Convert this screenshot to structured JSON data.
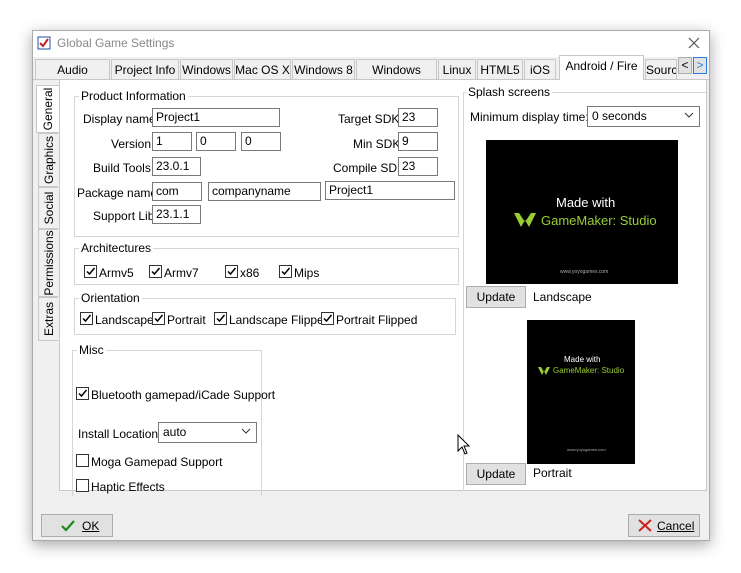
{
  "window": {
    "title": "Global Game Settings"
  },
  "tabs": [
    "Audio Groups",
    "Project Info",
    "Windows",
    "Mac OS X",
    "Windows 8",
    "Windows UWP",
    "Linux",
    "HTML5",
    "iOS",
    "Android / Fire",
    "Sourc"
  ],
  "tab_nav": {
    "prev": "<",
    "next": ">"
  },
  "side_tabs": [
    "General",
    "Graphics",
    "Social",
    "Permissions",
    "Extras"
  ],
  "product": {
    "heading": "Product Information",
    "display_name_label": "Display name",
    "display_name": "Project1",
    "version_label": "Version",
    "version": [
      "1",
      "0",
      "0"
    ],
    "build_tools_label": "Build Tools",
    "build_tools": "23.0.1",
    "package_label": "Package name",
    "package": [
      "com",
      "companyname",
      "Project1"
    ],
    "support_lib_label": "Support Lib",
    "support_lib": "23.1.1",
    "target_sdk_label": "Target SDK",
    "target_sdk": "23",
    "min_sdk_label": "Min SDK",
    "min_sdk": "9",
    "compile_sdk_label": "Compile SDK",
    "compile_sdk": "23"
  },
  "architectures": {
    "heading": "Architectures",
    "items": [
      "Armv5",
      "Armv7",
      "x86",
      "Mips"
    ]
  },
  "orientation": {
    "heading": "Orientation",
    "items": [
      "Landscape",
      "Portrait",
      "Landscape Flipped",
      "Portrait Flipped"
    ]
  },
  "misc": {
    "heading": "Misc",
    "bluetooth": "Bluetooth gamepad/iCade Support",
    "install_label": "Install Location:",
    "install_value": "auto",
    "moga": "Moga Gamepad Support",
    "haptic": "Haptic Effects"
  },
  "splash": {
    "heading": "Splash screens",
    "min_time_label": "Minimum display time:",
    "min_time_value": "0 seconds",
    "landscape_text1": "Made with",
    "landscape_text2": "GameMaker: Studio",
    "landscape_small": "www.yoyogames.com",
    "portrait_text1": "Made with",
    "portrait_text2": "GameMaker: Studio",
    "portrait_small": "www.yoyogames.com",
    "update": "Update",
    "landscape_label": "Landscape",
    "portrait_label": "Portrait"
  },
  "footer": {
    "ok": "OK",
    "cancel": "Cancel"
  },
  "colors": {
    "accent": "#2d7de1",
    "check": "#1a8a1a",
    "cancel_x": "#d02020",
    "gm_green": "#9acd32"
  }
}
